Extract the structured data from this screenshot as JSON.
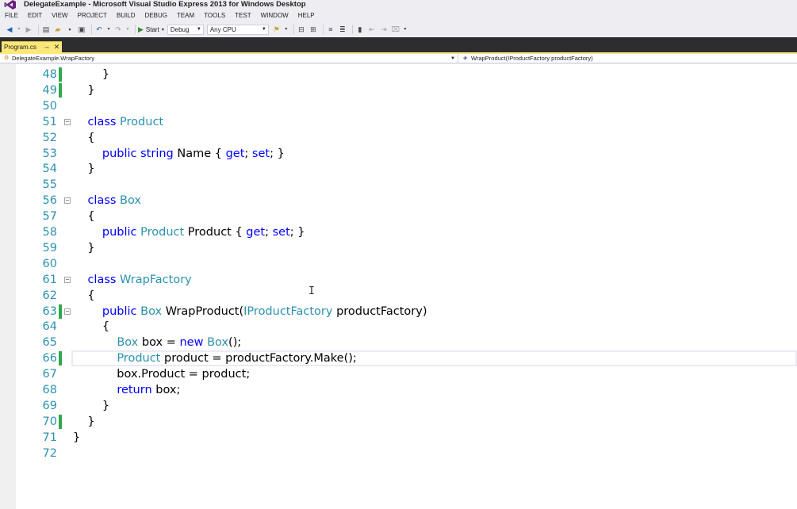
{
  "window": {
    "title": "DelegateExample - Microsoft Visual Studio Express 2013 for Windows Desktop"
  },
  "menu": [
    "FILE",
    "EDIT",
    "VIEW",
    "PROJECT",
    "BUILD",
    "DEBUG",
    "TEAM",
    "TOOLS",
    "TEST",
    "WINDOW",
    "HELP"
  ],
  "toolbar": {
    "start_label": "Start",
    "config_value": "Debug",
    "platform_value": "Any CPU"
  },
  "doc_tab": {
    "label": "Program.cs",
    "pin_icon": "pin-icon",
    "close_icon": "close-icon"
  },
  "navigation": {
    "type_scope": "DelegateExample.WrapFactory",
    "member_scope": "WrapProduct(IProductFactory productFactory)"
  },
  "editor": {
    "lines": [
      {
        "n": "48",
        "changed": true,
        "fold": "",
        "tokens": [
          [
            "        }",
            ""
          ]
        ]
      },
      {
        "n": "49",
        "changed": true,
        "fold": "",
        "tokens": [
          [
            "    }",
            ""
          ]
        ]
      },
      {
        "n": "50",
        "changed": false,
        "fold": "",
        "tokens": [
          [
            "",
            ""
          ]
        ]
      },
      {
        "n": "51",
        "changed": false,
        "fold": "−",
        "tokens": [
          [
            "    ",
            ""
          ],
          [
            "class",
            "kw"
          ],
          [
            " ",
            ""
          ],
          [
            "Product",
            "ty"
          ]
        ]
      },
      {
        "n": "52",
        "changed": false,
        "fold": "",
        "tokens": [
          [
            "    {",
            ""
          ]
        ]
      },
      {
        "n": "53",
        "changed": false,
        "fold": "",
        "tokens": [
          [
            "        ",
            ""
          ],
          [
            "public",
            "kw"
          ],
          [
            " ",
            ""
          ],
          [
            "string",
            "kw"
          ],
          [
            " Name { ",
            ""
          ],
          [
            "get",
            "kw"
          ],
          [
            "; ",
            ""
          ],
          [
            "set",
            "kw"
          ],
          [
            "; }",
            ""
          ]
        ]
      },
      {
        "n": "54",
        "changed": false,
        "fold": "",
        "tokens": [
          [
            "    }",
            ""
          ]
        ]
      },
      {
        "n": "55",
        "changed": false,
        "fold": "",
        "tokens": [
          [
            "",
            ""
          ]
        ]
      },
      {
        "n": "56",
        "changed": false,
        "fold": "−",
        "tokens": [
          [
            "    ",
            ""
          ],
          [
            "class",
            "kw"
          ],
          [
            " ",
            ""
          ],
          [
            "Box",
            "ty"
          ]
        ]
      },
      {
        "n": "57",
        "changed": false,
        "fold": "",
        "tokens": [
          [
            "    {",
            ""
          ]
        ]
      },
      {
        "n": "58",
        "changed": false,
        "fold": "",
        "tokens": [
          [
            "        ",
            ""
          ],
          [
            "public",
            "kw"
          ],
          [
            " ",
            ""
          ],
          [
            "Product",
            "ty"
          ],
          [
            " Product { ",
            ""
          ],
          [
            "get",
            "kw"
          ],
          [
            "; ",
            ""
          ],
          [
            "set",
            "kw"
          ],
          [
            "; }",
            ""
          ]
        ]
      },
      {
        "n": "59",
        "changed": false,
        "fold": "",
        "tokens": [
          [
            "    }",
            ""
          ]
        ]
      },
      {
        "n": "60",
        "changed": false,
        "fold": "",
        "tokens": [
          [
            "",
            ""
          ]
        ]
      },
      {
        "n": "61",
        "changed": false,
        "fold": "−",
        "tokens": [
          [
            "    ",
            ""
          ],
          [
            "class",
            "kw"
          ],
          [
            " ",
            ""
          ],
          [
            "WrapFactory",
            "ty"
          ]
        ]
      },
      {
        "n": "62",
        "changed": false,
        "fold": "",
        "tokens": [
          [
            "    {",
            ""
          ]
        ]
      },
      {
        "n": "63",
        "changed": true,
        "fold": "−",
        "tokens": [
          [
            "        ",
            ""
          ],
          [
            "public",
            "kw"
          ],
          [
            " ",
            ""
          ],
          [
            "Box",
            "ty"
          ],
          [
            " WrapProduct(",
            ""
          ],
          [
            "IProductFactory",
            "ty"
          ],
          [
            " productFactory)",
            ""
          ]
        ]
      },
      {
        "n": "64",
        "changed": false,
        "fold": "",
        "tokens": [
          [
            "        {",
            ""
          ]
        ]
      },
      {
        "n": "65",
        "changed": false,
        "fold": "",
        "tokens": [
          [
            "            ",
            ""
          ],
          [
            "Box",
            "ty"
          ],
          [
            " box = ",
            ""
          ],
          [
            "new",
            "kw"
          ],
          [
            " ",
            ""
          ],
          [
            "Box",
            "ty"
          ],
          [
            "();",
            ""
          ]
        ]
      },
      {
        "n": "66",
        "changed": true,
        "fold": "",
        "tokens": [
          [
            "            ",
            ""
          ],
          [
            "Product",
            "ty"
          ],
          [
            " product = productFactory.Make();",
            ""
          ]
        ]
      },
      {
        "n": "67",
        "changed": false,
        "fold": "",
        "tokens": [
          [
            "            box.Product = product;",
            ""
          ]
        ]
      },
      {
        "n": "68",
        "changed": false,
        "fold": "",
        "tokens": [
          [
            "            ",
            ""
          ],
          [
            "return",
            "kw"
          ],
          [
            " box;",
            ""
          ]
        ]
      },
      {
        "n": "69",
        "changed": false,
        "fold": "",
        "tokens": [
          [
            "        }",
            ""
          ]
        ]
      },
      {
        "n": "70",
        "changed": true,
        "fold": "",
        "tokens": [
          [
            "    }",
            ""
          ]
        ]
      },
      {
        "n": "71",
        "changed": false,
        "fold": "",
        "tokens": [
          [
            "}",
            ""
          ]
        ]
      },
      {
        "n": "72",
        "changed": false,
        "fold": "",
        "tokens": [
          [
            "",
            ""
          ]
        ]
      }
    ]
  },
  "colors": {
    "keyword": "#0000ff",
    "type": "#2b91af",
    "line_number": "#2b91af",
    "change_bar": "#2ea94d",
    "active_tab": "#fce77a"
  }
}
